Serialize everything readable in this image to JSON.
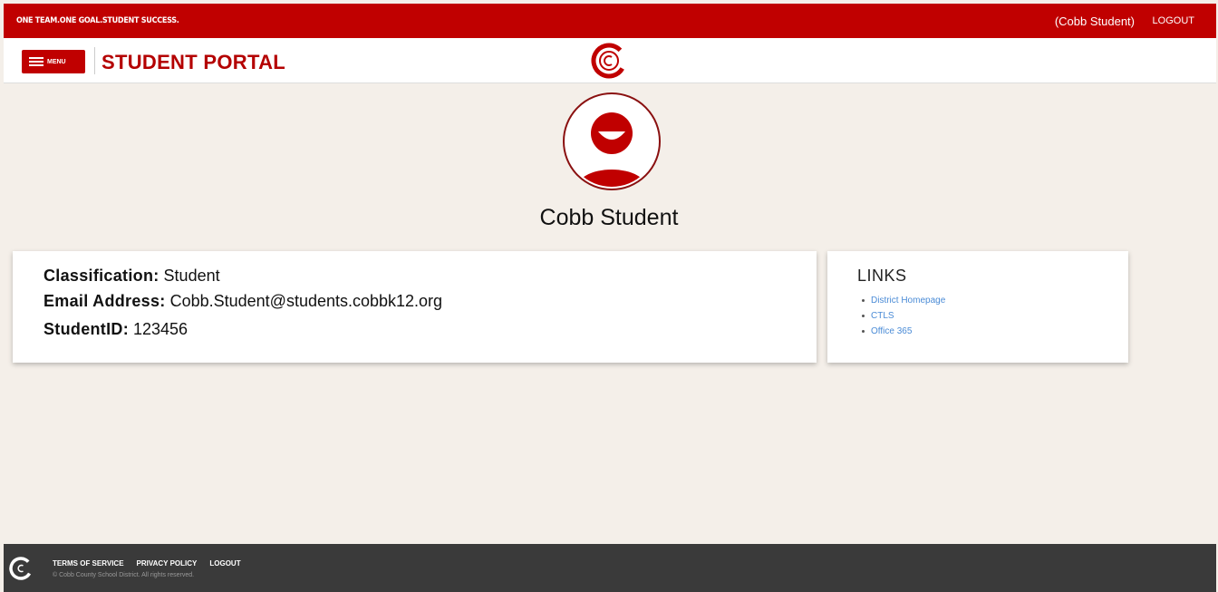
{
  "topbar": {
    "tagline": "ONE TEAM.ONE GOAL.STUDENT SUCCESS.",
    "user": "(Cobb Student)",
    "logout": "LOGOUT"
  },
  "navbar": {
    "menu_label": "MENU",
    "title": "STUDENT PORTAL",
    "logo_icon": "cobb-c-logo-icon"
  },
  "profile": {
    "avatar_icon": "user-avatar-icon",
    "name": "Cobb Student"
  },
  "info": {
    "classification_label": "Classification:",
    "classification_value": "Student",
    "email_label": "Email Address:",
    "email_value": "Cobb.Student@students.cobbk12.org",
    "id_label": "StudentID:",
    "id_value": "123456"
  },
  "links": {
    "title": "LINKS",
    "items": [
      "District Homepage",
      "CTLS",
      "Office 365"
    ]
  },
  "footer": {
    "links": [
      "TERMS OF SERVICE",
      "PRIVACY POLICY",
      "LOGOUT"
    ],
    "copyright": "© Cobb County School District. All rights reserved."
  },
  "colors": {
    "brand_red": "#c00000",
    "background": "#f4efe9",
    "footer": "#3a3a3a",
    "link_blue": "#4a8bd6"
  }
}
